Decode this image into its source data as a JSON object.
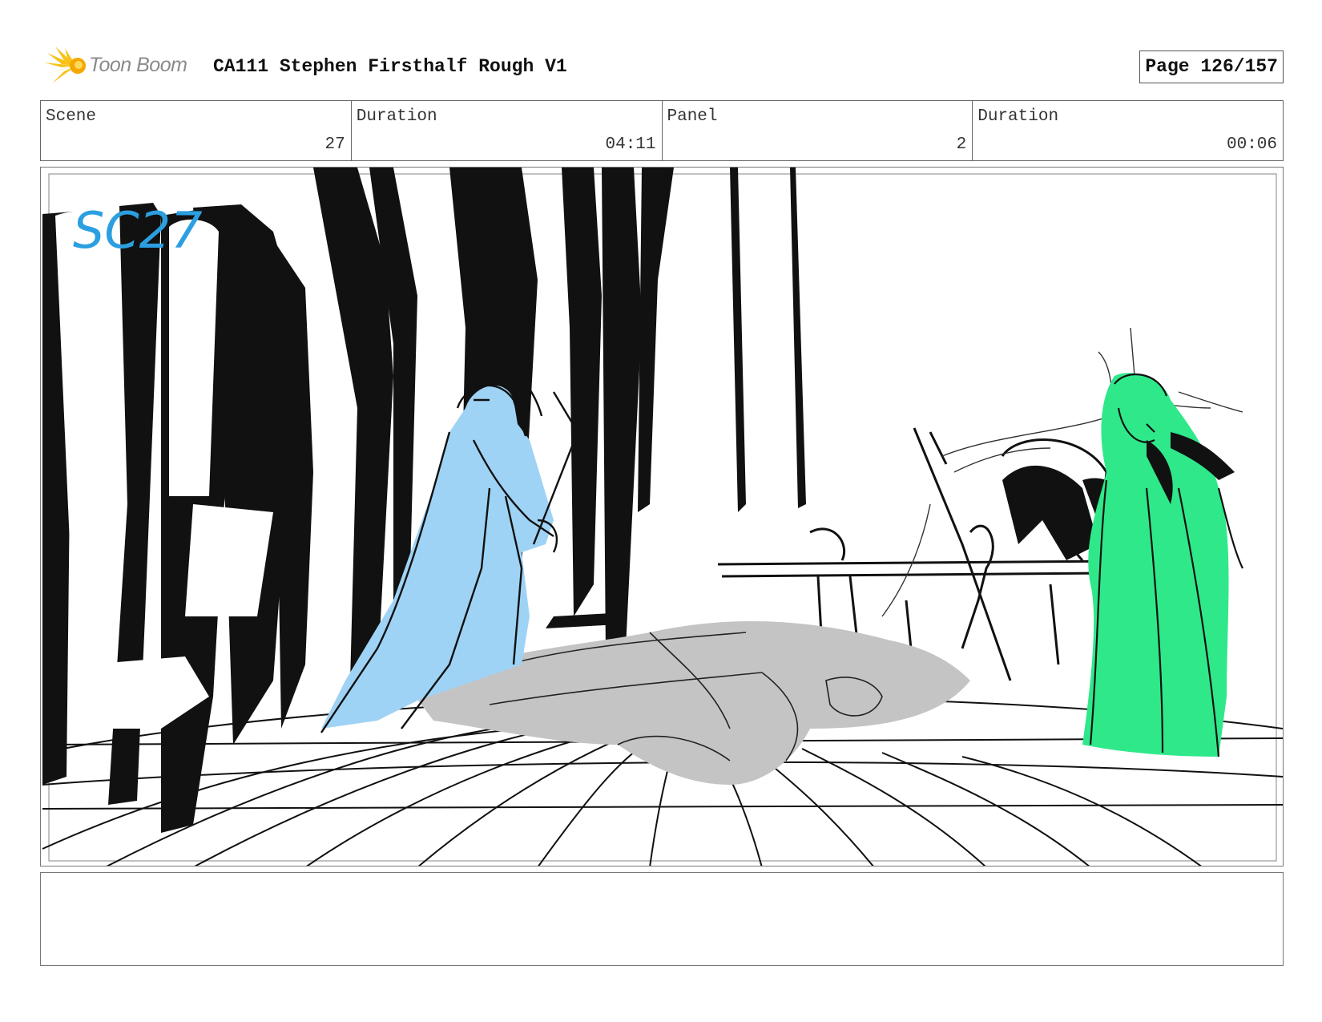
{
  "header": {
    "logo_text": "Toon Boom",
    "title": "CA111 Stephen Firsthalf Rough V1",
    "page_label": "Page 126/157"
  },
  "info": {
    "scene_label": "Scene",
    "scene_value": "27",
    "scene_duration_label": "Duration",
    "scene_duration_value": "04:11",
    "panel_label": "Panel",
    "panel_value": "2",
    "panel_duration_label": "Duration",
    "panel_duration_value": "00:06"
  },
  "panel": {
    "handwritten_note": "SC27",
    "colors": {
      "knight_fill": "#9fd3f5",
      "lady_fill": "#2fe88a",
      "fallen_figure_fill": "#c4c4c4",
      "note_color": "#2b9fe0",
      "ink": "#111111"
    }
  },
  "notes": {
    "text": ""
  }
}
